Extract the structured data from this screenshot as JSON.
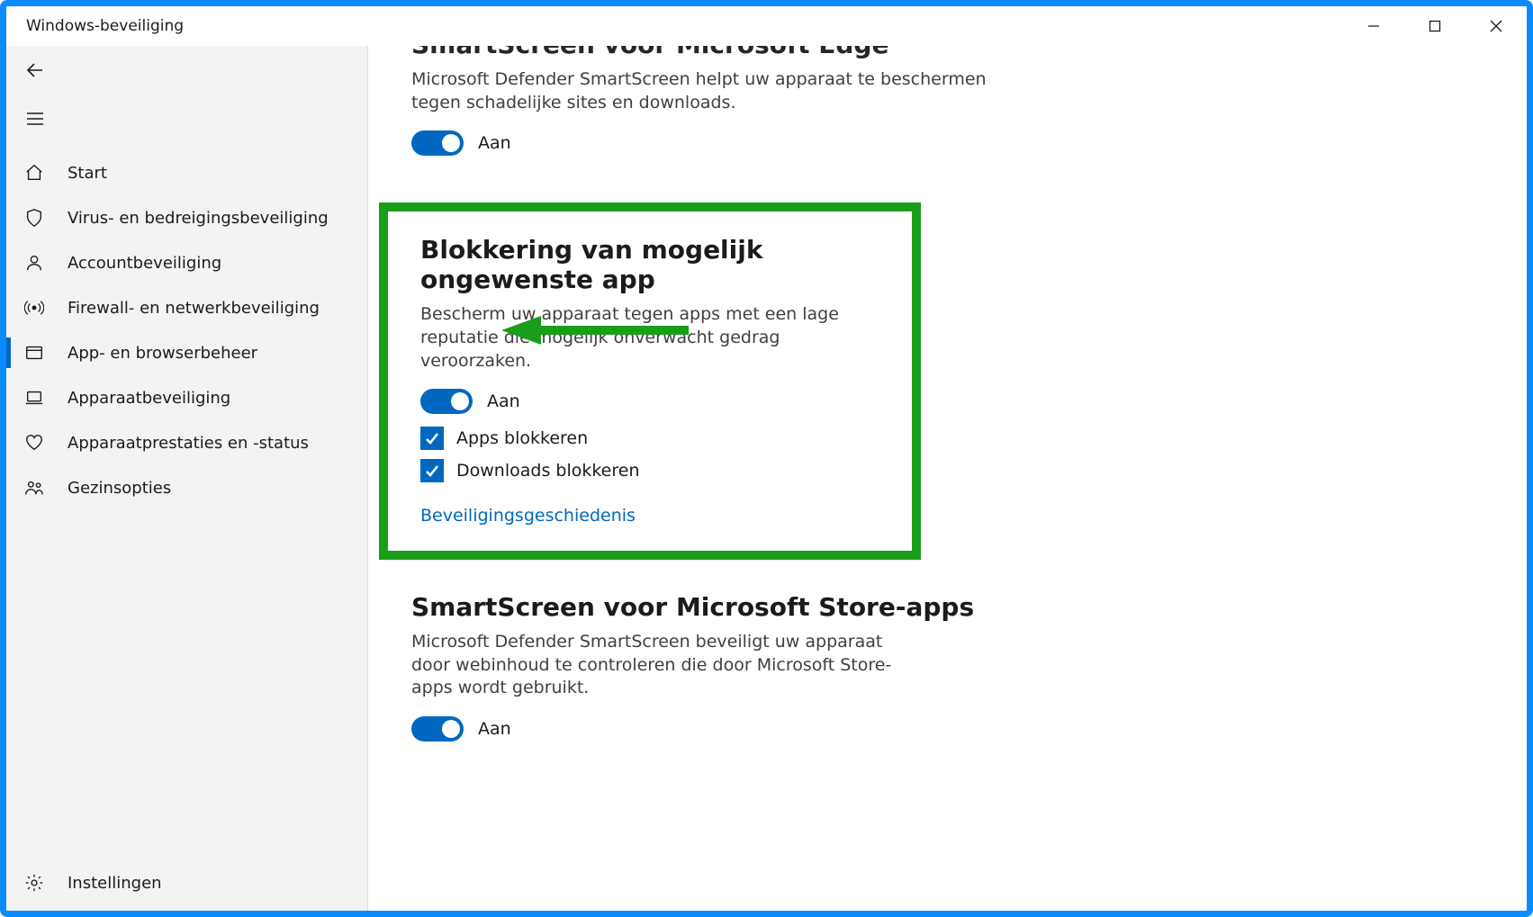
{
  "window": {
    "title": "Windows-beveiliging"
  },
  "sidebar": {
    "items": [
      {
        "key": "home",
        "label": "Start",
        "icon": "home-icon"
      },
      {
        "key": "virus",
        "label": "Virus- en bedreigingsbeveiliging",
        "icon": "shield-icon"
      },
      {
        "key": "account",
        "label": "Accountbeveiliging",
        "icon": "person-icon"
      },
      {
        "key": "firewall",
        "label": "Firewall- en netwerkbeveiliging",
        "icon": "antenna-icon"
      },
      {
        "key": "app",
        "label": "App- en browserbeheer",
        "icon": "browser-icon",
        "active": true
      },
      {
        "key": "device",
        "label": "Apparaatbeveiliging",
        "icon": "laptop-icon"
      },
      {
        "key": "health",
        "label": "Apparaatprestaties en -status",
        "icon": "heart-icon"
      },
      {
        "key": "family",
        "label": "Gezinsopties",
        "icon": "family-icon"
      }
    ],
    "settings_label": "Instellingen"
  },
  "sections": {
    "edge": {
      "heading": "SmartScreen voor Microsoft Edge",
      "description": "Microsoft Defender SmartScreen helpt uw apparaat te beschermen tegen schadelijke sites en downloads.",
      "toggle_label": "Aan"
    },
    "pua": {
      "heading": "Blokkering van mogelijk ongewenste app",
      "description": "Bescherm uw apparaat tegen apps met een lage reputatie die mogelijk onverwacht gedrag veroorzaken.",
      "toggle_label": "Aan",
      "check_apps": "Apps blokkeren",
      "check_downloads": "Downloads blokkeren",
      "history_link": "Beveiligingsgeschiedenis"
    },
    "store": {
      "heading": "SmartScreen voor Microsoft Store-apps",
      "description": "Microsoft Defender SmartScreen beveiligt uw apparaat door webinhoud te controleren die door Microsoft Store-apps wordt gebruikt.",
      "toggle_label": "Aan"
    }
  }
}
